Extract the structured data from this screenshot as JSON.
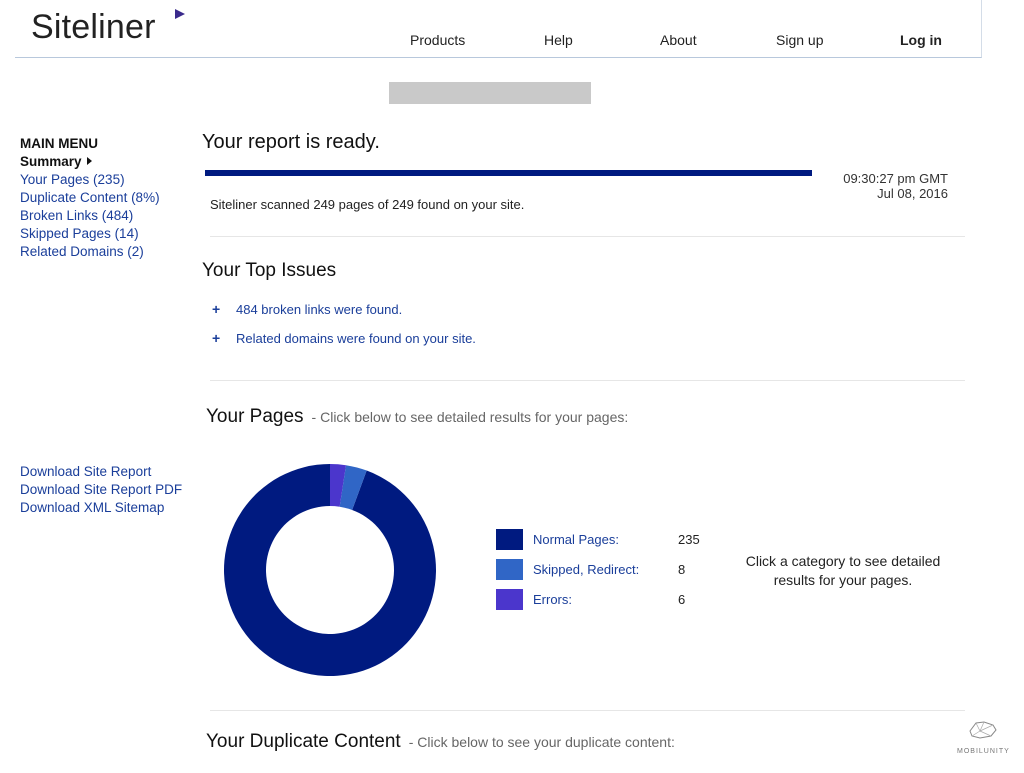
{
  "header": {
    "logo": "Siteliner",
    "nav": {
      "products": "Products",
      "help": "Help",
      "about": "About",
      "signup": "Sign up",
      "login": "Log in"
    }
  },
  "sidebar": {
    "heading": "MAIN MENU",
    "current": "Summary",
    "items": [
      "Your Pages (235)",
      "Duplicate Content (8%)",
      "Broken Links (484)",
      "Skipped Pages (14)",
      "Related Domains (2)"
    ],
    "downloads": [
      "Download Site Report",
      "Download Site Report PDF",
      "Download XML Sitemap"
    ]
  },
  "report": {
    "title": "Your report is ready.",
    "progress": 1.0,
    "time": "09:30:27 pm GMT",
    "date": "Jul 08, 2016",
    "scan_text": "Siteliner scanned 249 pages of 249 found on your site."
  },
  "issues": {
    "title": "Your Top Issues",
    "items": [
      "484 broken links were found.",
      "Related domains were found on your site."
    ]
  },
  "pages_section": {
    "title": "Your Pages",
    "subtitle": "- Click below to see detailed results for your pages:",
    "hint": "Click a category to see detailed results for your pages."
  },
  "chart_data": {
    "type": "pie",
    "donut": true,
    "categories": [
      "Normal Pages:",
      "Skipped, Redirect:",
      "Errors:"
    ],
    "values": [
      235,
      8,
      6
    ],
    "colors": [
      "#001a80",
      "#3066c6",
      "#4b36cc"
    ]
  },
  "duplicate_section": {
    "title": "Your Duplicate Content",
    "subtitle": "- Click below to see your duplicate content:"
  },
  "watermark": {
    "text": "MOBILUNITY",
    "icon": "whale-icon"
  }
}
